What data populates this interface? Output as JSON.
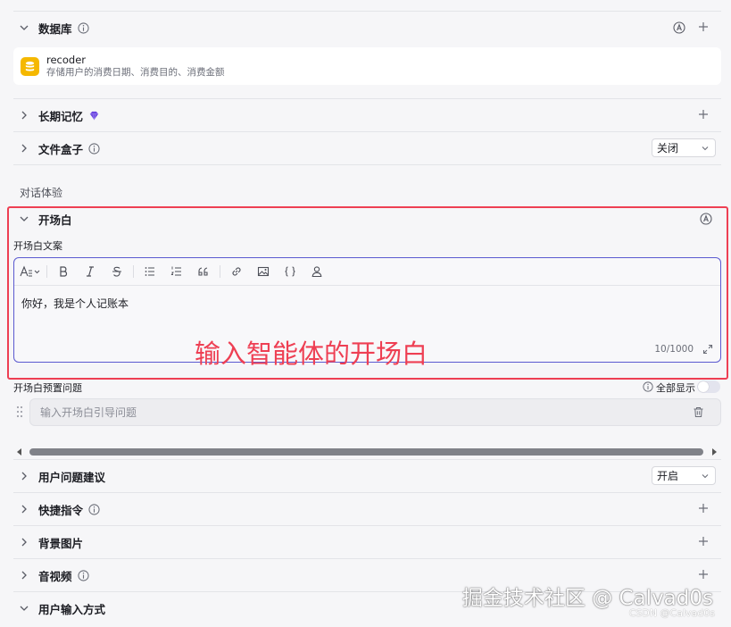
{
  "sections": {
    "database": {
      "title": "数据库"
    },
    "long_memory": {
      "title": "长期记忆"
    },
    "file_box": {
      "title": "文件盒子",
      "select_value": "关闭"
    },
    "opening": {
      "title": "开场白"
    },
    "suggestions": {
      "title": "用户问题建议",
      "select_value": "开启"
    },
    "shortcuts": {
      "title": "快捷指令"
    },
    "background": {
      "title": "背景图片"
    },
    "audio_video": {
      "title": "音视频"
    },
    "input_mode": {
      "title": "用户输入方式"
    }
  },
  "database_card": {
    "name": "recoder",
    "description": "存储用户的消费日期、消费目的、消费金额"
  },
  "conversation_experience_label": "对话体验",
  "opening_editor": {
    "label": "开场白文案",
    "content": "你好，我是个人记账本",
    "char_count": "10/1000",
    "toolbar_icons": [
      "font-style-icon",
      "bold-icon",
      "italic-icon",
      "strikethrough-icon",
      "bullet-list-icon",
      "ordered-list-icon",
      "quote-icon",
      "link-icon",
      "image-icon",
      "variable-braces-icon",
      "user-icon"
    ]
  },
  "preset_questions": {
    "label": "开场白预置问题",
    "show_all_label": "全部显示",
    "placeholder": "输入开场白引导问题"
  },
  "annotation_text": "输入智能体的开场白",
  "watermark": {
    "main": "掘金技术社区 @ Calvad0s",
    "small": "CSDN @Calvad0s"
  },
  "colors": {
    "accent": "#5b5ad0",
    "highlight_red": "#ee3f53",
    "database_icon": "#f5b800",
    "premium_gem": "#6b46e0"
  }
}
